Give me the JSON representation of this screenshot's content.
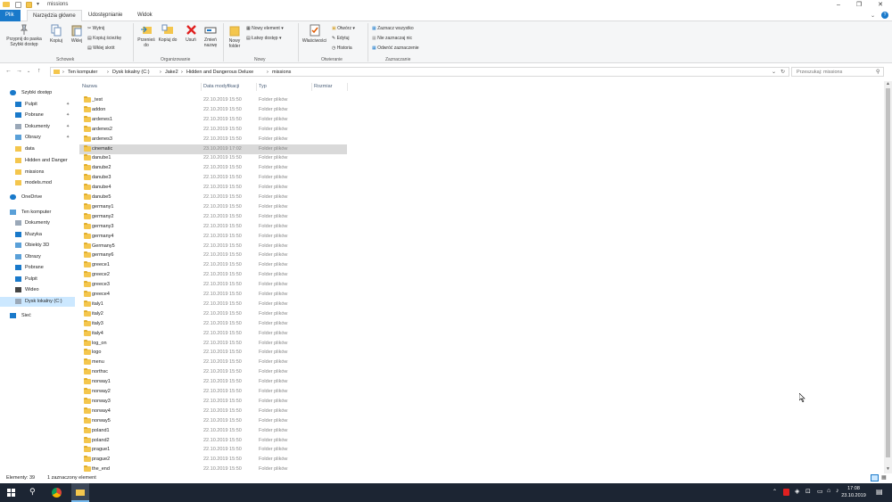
{
  "window": {
    "title": "missions",
    "colors": {
      "accent": "#1979ca",
      "folder": "#f4c64d",
      "taskbar": "#1c2533",
      "selected_nav": "#cce8ff"
    }
  },
  "ribbon_tabs": [
    {
      "label": "Plik"
    },
    {
      "label": "Narzędzia główne"
    },
    {
      "label": "Udostępnianie"
    },
    {
      "label": "Widok"
    }
  ],
  "ribbon": {
    "pin_label": "Przypnij do paska Szybki dostęp",
    "copy_label": "Kopiuj",
    "paste_label": "Wklej",
    "cut_label": "Wytnij",
    "copy_path_label": "Kopiuj ścieżkę",
    "paste_shortcut_label": "Wklej skrót",
    "clipboard_group": "Schowek",
    "move_to_label": "Przenieś do",
    "copy_to_label": "Kopiuj do",
    "delete_label": "Usuń",
    "rename_label": "Zmień nazwę",
    "organize_group": "Organizowanie",
    "new_folder_label": "Nowy folder",
    "new_item_label": "Nowy element",
    "easy_access_label": "Łatwy dostęp",
    "new_group": "Nowy",
    "properties_label": "Właściwości",
    "open_label": "Otwórz",
    "edit_label": "Edytuj",
    "history_label": "Historia",
    "open_group": "Otwieranie",
    "select_all_label": "Zaznacz wszystko",
    "select_none_label": "Nie zaznaczaj nic",
    "invert_selection_label": "Odwróć zaznaczenie",
    "select_group": "Zaznaczanie"
  },
  "address": {
    "crumbs": [
      "Ten komputer",
      "Dysk lokalny (C:)",
      "Jake2",
      "Hidden and Dangerous Deluxe",
      "missions"
    ],
    "search_placeholder": "Przeszukaj: missions"
  },
  "sidebar": {
    "items": [
      {
        "label": "Szybki dostęp",
        "icon": "star-icon"
      },
      {
        "label": "Pulpit",
        "icon": "desktop-icon",
        "pinned": true
      },
      {
        "label": "Pobrane",
        "icon": "download-icon",
        "pinned": true
      },
      {
        "label": "Dokumenty",
        "icon": "document-icon",
        "pinned": true
      },
      {
        "label": "Obrazy",
        "icon": "picture-icon",
        "pinned": true
      },
      {
        "label": "data",
        "icon": "folder-icon"
      },
      {
        "label": "Hidden and Danger",
        "icon": "folder-icon"
      },
      {
        "label": "missions",
        "icon": "folder-icon"
      },
      {
        "label": "models.mod",
        "icon": "folder-icon"
      },
      {
        "label": "OneDrive",
        "icon": "cloud-icon"
      },
      {
        "label": "Ten komputer",
        "icon": "computer-icon"
      },
      {
        "label": "Dokumenty",
        "icon": "document-icon"
      },
      {
        "label": "Muzyka",
        "icon": "music-icon"
      },
      {
        "label": "Obiekty 3D",
        "icon": "cube-icon"
      },
      {
        "label": "Obrazy",
        "icon": "picture-icon"
      },
      {
        "label": "Pobrane",
        "icon": "download-icon"
      },
      {
        "label": "Pulpit",
        "icon": "desktop-icon"
      },
      {
        "label": "Wideo",
        "icon": "video-icon"
      },
      {
        "label": "Dysk lokalny (C:)",
        "icon": "drive-icon",
        "selected": true
      },
      {
        "label": "Sieć",
        "icon": "network-icon"
      }
    ]
  },
  "columns": {
    "name": "Nazwa",
    "date": "Data modyfikacji",
    "type": "Typ",
    "size": "Rozmiar"
  },
  "files": [
    {
      "name": "_test",
      "date": "22.10.2019 15:50",
      "type": "Folder plików"
    },
    {
      "name": "addon",
      "date": "22.10.2019 15:50",
      "type": "Folder plików"
    },
    {
      "name": "ardenes1",
      "date": "22.10.2019 15:50",
      "type": "Folder plików"
    },
    {
      "name": "ardenes2",
      "date": "22.10.2019 15:50",
      "type": "Folder plików"
    },
    {
      "name": "ardenes3",
      "date": "22.10.2019 15:50",
      "type": "Folder plików"
    },
    {
      "name": "cinematic",
      "date": "23.10.2019 17:02",
      "type": "Folder plików",
      "selected": true
    },
    {
      "name": "danube1",
      "date": "22.10.2019 15:50",
      "type": "Folder plików"
    },
    {
      "name": "danube2",
      "date": "22.10.2019 15:50",
      "type": "Folder plików"
    },
    {
      "name": "danube3",
      "date": "22.10.2019 15:50",
      "type": "Folder plików"
    },
    {
      "name": "danube4",
      "date": "22.10.2019 15:50",
      "type": "Folder plików"
    },
    {
      "name": "danube5",
      "date": "22.10.2019 15:50",
      "type": "Folder plików"
    },
    {
      "name": "germany1",
      "date": "22.10.2019 15:50",
      "type": "Folder plików"
    },
    {
      "name": "germany2",
      "date": "22.10.2019 15:50",
      "type": "Folder plików"
    },
    {
      "name": "germany3",
      "date": "22.10.2019 15:50",
      "type": "Folder plików"
    },
    {
      "name": "germany4",
      "date": "22.10.2019 15:50",
      "type": "Folder plików"
    },
    {
      "name": "Germany5",
      "date": "22.10.2019 15:50",
      "type": "Folder plików"
    },
    {
      "name": "germany6",
      "date": "22.10.2019 15:50",
      "type": "Folder plików"
    },
    {
      "name": "greece1",
      "date": "22.10.2019 15:50",
      "type": "Folder plików"
    },
    {
      "name": "greece2",
      "date": "22.10.2019 15:50",
      "type": "Folder plików"
    },
    {
      "name": "greece3",
      "date": "22.10.2019 15:50",
      "type": "Folder plików"
    },
    {
      "name": "greece4",
      "date": "22.10.2019 15:50",
      "type": "Folder plików"
    },
    {
      "name": "italy1",
      "date": "22.10.2019 15:50",
      "type": "Folder plików"
    },
    {
      "name": "italy2",
      "date": "22.10.2019 15:50",
      "type": "Folder plików"
    },
    {
      "name": "italy3",
      "date": "22.10.2019 15:50",
      "type": "Folder plików"
    },
    {
      "name": "italy4",
      "date": "22.10.2019 15:50",
      "type": "Folder plików"
    },
    {
      "name": "log_on",
      "date": "22.10.2019 15:50",
      "type": "Folder plików"
    },
    {
      "name": "logo",
      "date": "22.10.2019 15:50",
      "type": "Folder plików"
    },
    {
      "name": "menu",
      "date": "22.10.2019 15:50",
      "type": "Folder plików"
    },
    {
      "name": "northsc",
      "date": "22.10.2019 15:50",
      "type": "Folder plików"
    },
    {
      "name": "norway1",
      "date": "22.10.2019 15:50",
      "type": "Folder plików"
    },
    {
      "name": "norway2",
      "date": "22.10.2019 15:50",
      "type": "Folder plików"
    },
    {
      "name": "norway3",
      "date": "22.10.2019 15:50",
      "type": "Folder plików"
    },
    {
      "name": "norway4",
      "date": "22.10.2019 15:50",
      "type": "Folder plików"
    },
    {
      "name": "norway5",
      "date": "22.10.2019 15:50",
      "type": "Folder plików"
    },
    {
      "name": "poland1",
      "date": "22.10.2019 15:50",
      "type": "Folder plików"
    },
    {
      "name": "poland2",
      "date": "22.10.2019 15:50",
      "type": "Folder plików"
    },
    {
      "name": "prague1",
      "date": "22.10.2019 15:50",
      "type": "Folder plików"
    },
    {
      "name": "prague2",
      "date": "22.10.2019 15:50",
      "type": "Folder plików"
    },
    {
      "name": "the_end",
      "date": "22.10.2019 15:50",
      "type": "Folder plików"
    }
  ],
  "status": {
    "count": "Elementy: 39",
    "selection": "1 zaznaczony element"
  },
  "taskbar": {
    "time": "17:08",
    "date": "23.10.2019"
  }
}
